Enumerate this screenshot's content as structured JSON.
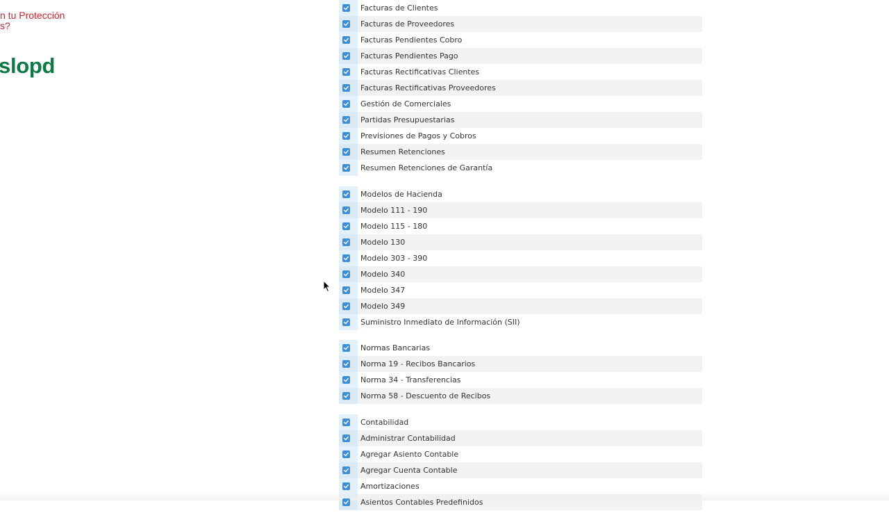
{
  "promo": {
    "line1": "n tu Protección",
    "line2": "s?"
  },
  "brand": {
    "text": "slopd",
    "color": "#0d7a44"
  },
  "accent": {
    "checkbox": "#3b8fd9",
    "promo_text": "#d4202f"
  },
  "groups": [
    {
      "items": [
        "Facturas de Clientes",
        "Facturas de Proveedores",
        "Facturas Pendientes Cobro",
        "Facturas Pendientes Pago",
        "Facturas Rectificativas Clientes",
        "Facturas Rectificativas Proveedores",
        "Gestión de Comerciales",
        "Partidas Presupuestarias",
        "Previsiones de Pagos y Cobros",
        "Resumen Retenciones",
        "Resumen Retenciones de Garantía"
      ]
    },
    {
      "items": [
        "Modelos de Hacienda",
        "Modelo 111 - 190",
        "Modelo 115 - 180",
        "Modelo 130",
        "Modelo 303 - 390",
        "Modelo 340",
        "Modelo 347",
        "Modelo 349",
        "Suministro Inmediato de Información (SII)"
      ]
    },
    {
      "items": [
        "Normas Bancarias",
        "Norma 19 - Recibos Bancarios",
        "Norma 34 - Transferencias",
        "Norma 58 - Descuento de Recibos"
      ]
    },
    {
      "items": [
        "Contabilidad",
        "Administrar Contabilidad",
        "Agregar Asiento Contable",
        "Agregar Cuenta Contable",
        "Amortizaciones",
        "Asientos Contables Predefinidos"
      ]
    }
  ]
}
